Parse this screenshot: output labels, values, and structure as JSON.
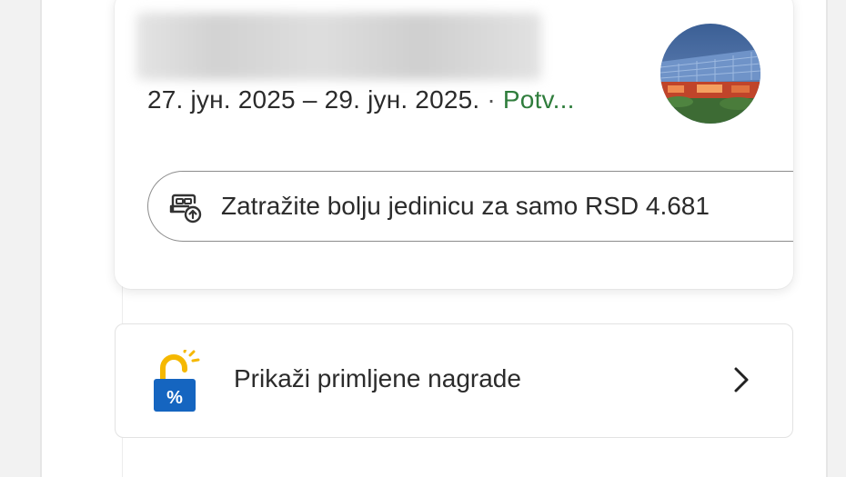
{
  "booking": {
    "dates": "27. јун. 2025 – 29. јун. 2025.",
    "separator": "·",
    "status": "Potv...",
    "photo_icon": "hotel-photo",
    "upgrade": {
      "icon": "bed-upgrade-icon",
      "label": "Zatražite bolju jedinicu za samo RSD 4.681"
    }
  },
  "rewards": {
    "icon": "unlocked-discount-icon",
    "label": "Prikaži primljene nagrade",
    "chevron": "chevron-right-icon"
  },
  "colors": {
    "status_green": "#2f7d3c",
    "rewards_blue": "#1565c0",
    "rewards_gold": "#f5b800"
  }
}
